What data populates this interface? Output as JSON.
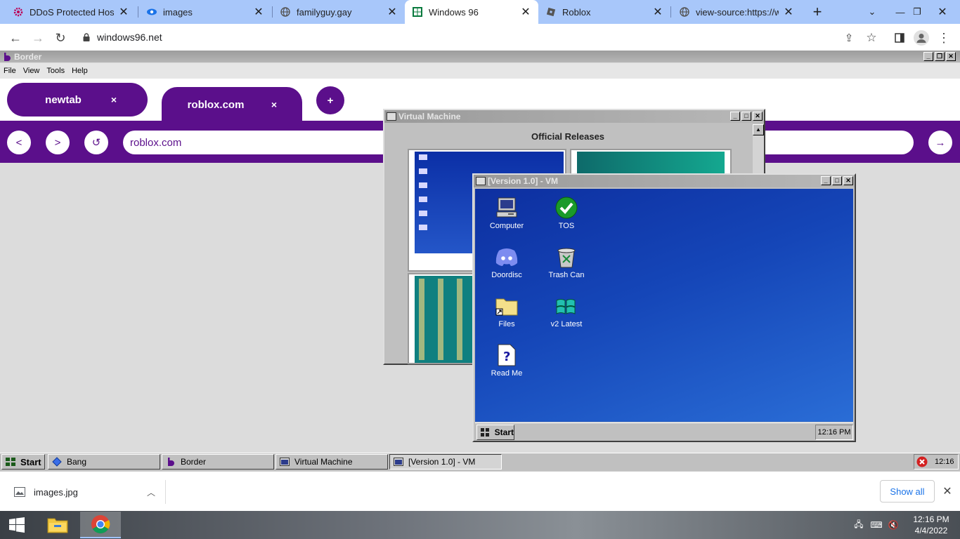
{
  "chrome": {
    "tabs": [
      {
        "title": "DDoS Protected Hostin",
        "icon": "gear-icon"
      },
      {
        "title": "images",
        "icon": "eye-icon"
      },
      {
        "title": "familyguy.gay",
        "icon": "globe-icon"
      },
      {
        "title": "Windows 96",
        "icon": "windows-icon",
        "active": true
      },
      {
        "title": "Roblox",
        "icon": "roblox-icon"
      },
      {
        "title": "view-source:https://win",
        "icon": "globe-icon"
      }
    ],
    "new_tab": "+",
    "tab_close": "✕",
    "url": "windows96.net",
    "accent": "#a8c7fa"
  },
  "border_app": {
    "title": "Border",
    "menu": [
      "File",
      "View",
      "Tools",
      "Help"
    ],
    "tabs": [
      {
        "title": "newtab"
      },
      {
        "title": "roblox.com"
      }
    ],
    "tab_close": "×",
    "add_tab": "+",
    "nav": {
      "back": "<",
      "forward": ">",
      "reload": "↺",
      "go": "→"
    },
    "url": "roblox.com",
    "accent": "#5b0f8b"
  },
  "vm_window": {
    "title": "Virtual Machine",
    "heading": "Official Releases"
  },
  "vm_inner": {
    "title": "[Version 1.0] - VM",
    "icons": [
      {
        "label": "Computer",
        "icon": "computer-icon"
      },
      {
        "label": "TOS",
        "icon": "checkmark-icon"
      },
      {
        "label": "Doordisc",
        "icon": "discord-icon"
      },
      {
        "label": "Trash Can",
        "icon": "trash-icon"
      },
      {
        "label": "Files",
        "icon": "folder-icon"
      },
      {
        "label": "v2 Latest",
        "icon": "windows-logo-icon"
      },
      {
        "label": "Read Me",
        "icon": "readme-icon"
      }
    ],
    "start": "Start",
    "clock": "12:16 PM"
  },
  "w96_taskbar": {
    "start": "Start",
    "items": [
      "Bang",
      "Border",
      "Virtual Machine",
      "[Version 1.0] - VM"
    ],
    "clock": "12:16"
  },
  "downloads": {
    "file": "images.jpg",
    "show_all": "Show all"
  },
  "win_taskbar": {
    "time": "12:16 PM",
    "date": "4/4/2022"
  }
}
